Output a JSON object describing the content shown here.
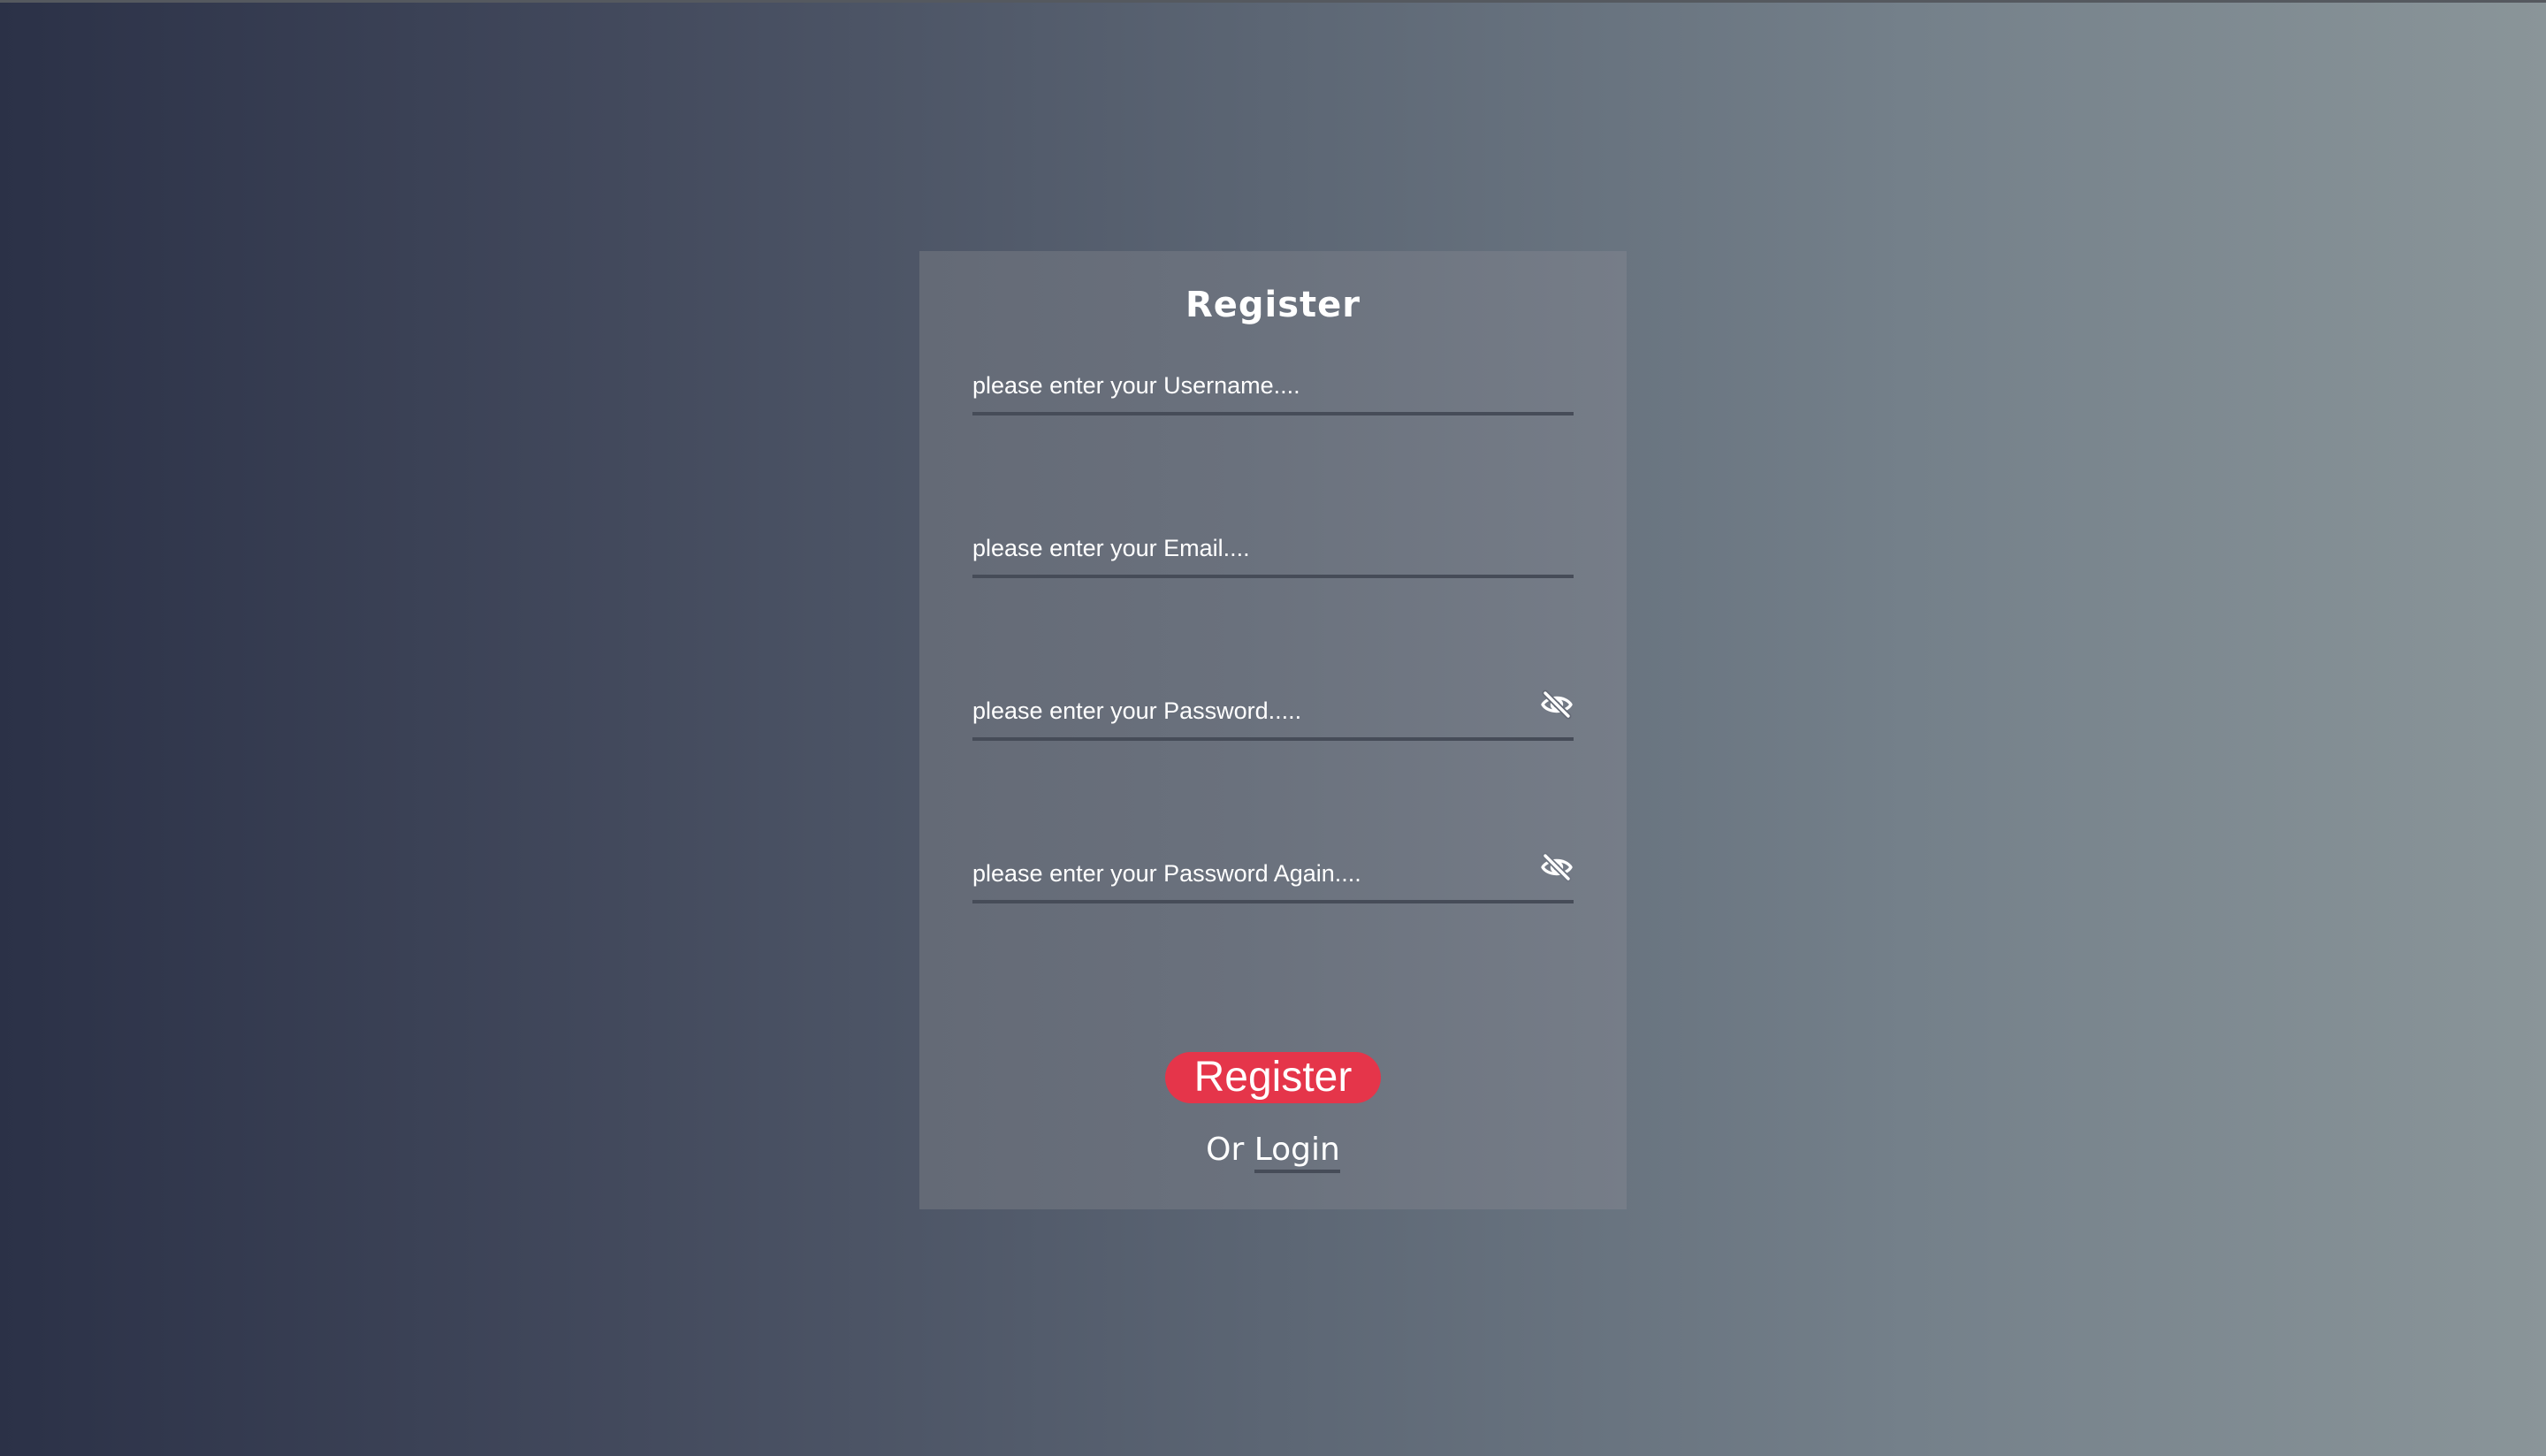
{
  "form": {
    "title": "Register",
    "username": {
      "placeholder": "please enter your Username....",
      "value": ""
    },
    "email": {
      "placeholder": "please enter your Email....",
      "value": ""
    },
    "password": {
      "placeholder": "please enter your Password.....",
      "value": "",
      "toggle_icon": "eye-slash-icon"
    },
    "password_again": {
      "placeholder": "please enter your Password Again....",
      "value": "",
      "toggle_icon": "eye-slash-icon"
    },
    "submit_label": "Register",
    "alt_prefix": "Or",
    "login_label": "Login"
  },
  "colors": {
    "accent": "#e5354a",
    "underline": "#464c58",
    "text": "#ffffff"
  }
}
